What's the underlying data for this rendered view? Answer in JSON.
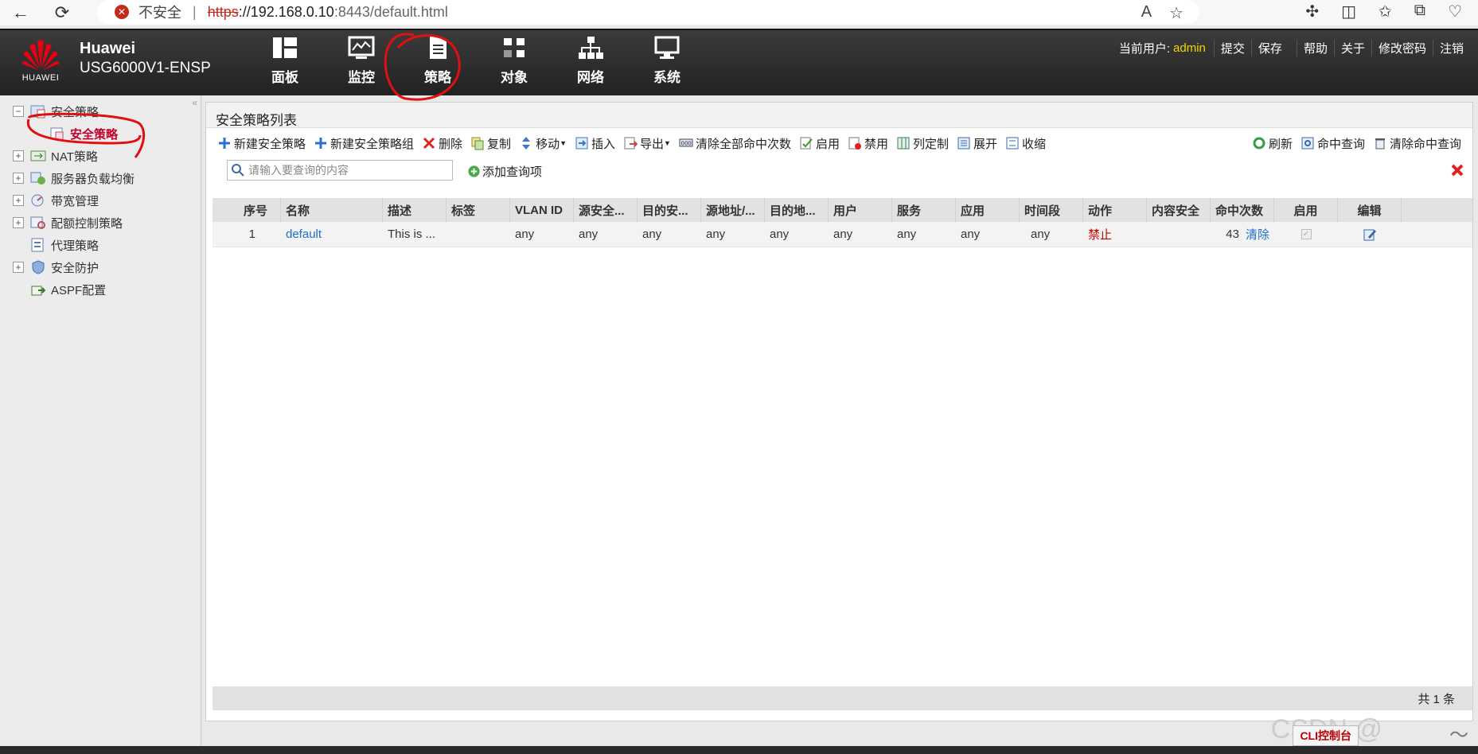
{
  "browser": {
    "insecure_label": "不安全",
    "url_scheme": "https",
    "url_host": "://192.168.0.10",
    "url_path": ":8443/default.html"
  },
  "header": {
    "logo_text": "HUAWEI",
    "brand_name": "Huawei",
    "brand_model": "USG6000V1-ENSP",
    "nav": [
      "面板",
      "监控",
      "策略",
      "对象",
      "网络",
      "系统"
    ],
    "current_user_label": "当前用户:",
    "current_user": "admin",
    "links": [
      "提交",
      "保存",
      "帮助",
      "关于",
      "修改密码",
      "注销"
    ]
  },
  "sidebar": {
    "items": [
      {
        "label": "安全策略",
        "toggle": "−"
      },
      {
        "label": "安全策略",
        "child": true
      },
      {
        "label": "NAT策略",
        "toggle": "+"
      },
      {
        "label": "服务器负载均衡",
        "toggle": "+"
      },
      {
        "label": "带宽管理",
        "toggle": "+"
      },
      {
        "label": "配额控制策略",
        "toggle": "+"
      },
      {
        "label": "代理策略",
        "toggle": ""
      },
      {
        "label": "安全防护",
        "toggle": "+"
      },
      {
        "label": "ASPF配置",
        "toggle": ""
      }
    ]
  },
  "panel": {
    "title": "安全策略列表",
    "toolbar": [
      "新建安全策略",
      "新建安全策略组",
      "删除",
      "复制",
      "移动",
      "插入",
      "导出",
      "清除全部命中次数",
      "启用",
      "禁用",
      "列定制",
      "展开",
      "收缩"
    ],
    "toolbar_right": [
      "刷新",
      "命中查询",
      "清除命中查询"
    ],
    "search_placeholder": "请输入要查询的内容",
    "add_query": "添加查询项",
    "columns": [
      "序号",
      "名称",
      "描述",
      "标签",
      "VLAN ID",
      "源安全...",
      "目的安...",
      "源地址/...",
      "目的地...",
      "用户",
      "服务",
      "应用",
      "时间段",
      "动作",
      "内容安全",
      "命中次数",
      "启用",
      "编辑"
    ],
    "rows": [
      {
        "index": "1",
        "name": "default",
        "desc": "This is ...",
        "tag": "",
        "vlan": "any",
        "src_zone": "any",
        "dst_zone": "any",
        "src_addr": "any",
        "dst_addr": "any",
        "user": "any",
        "service": "any",
        "app": "any",
        "time": "any",
        "action": "禁止",
        "content": "",
        "hits": "43",
        "clear": "清除"
      }
    ],
    "total": "共 1 条"
  },
  "bottom": {
    "cli": "CLI控制台",
    "watermark": "CSDN @"
  },
  "colors": {
    "accent_red": "#c0002a",
    "user_yellow": "#f5d300",
    "link_blue": "#1f6fcc"
  }
}
